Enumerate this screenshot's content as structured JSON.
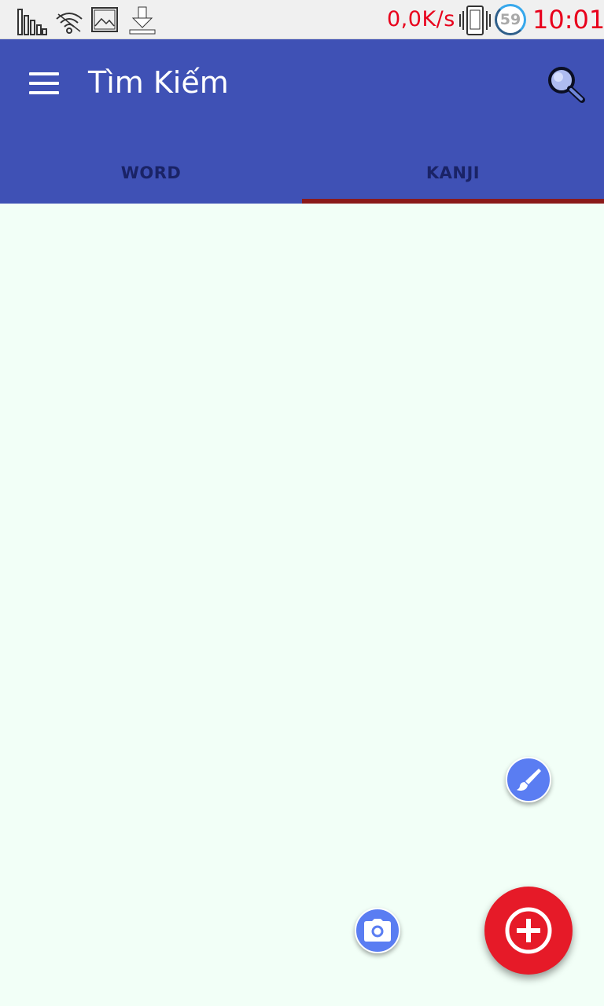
{
  "status_bar": {
    "network_speed": "0,0K/s",
    "battery_level": "59",
    "time": "10:01",
    "icons": [
      "signal-bars-icon",
      "wifi-icon",
      "image-icon",
      "download-icon",
      "vibrate-icon"
    ]
  },
  "app_bar": {
    "title": "Tìm Kiếm",
    "menu_icon": "hamburger-menu-icon",
    "search_icon": "search-icon",
    "color": "#3f51b5"
  },
  "tabs": [
    {
      "label": "WORD",
      "selected": false
    },
    {
      "label": "KANJI",
      "selected": true
    }
  ],
  "fabs": {
    "brush": {
      "icon": "brush-icon",
      "color": "#5a7df2"
    },
    "camera": {
      "icon": "camera-icon",
      "color": "#5a7df2"
    },
    "main": {
      "icon": "add-circle-icon",
      "color": "#e61a28"
    }
  },
  "colors": {
    "accent_indicator": "#8b1a1a",
    "status_text": "#e8001c",
    "background": "#f2fff7"
  }
}
